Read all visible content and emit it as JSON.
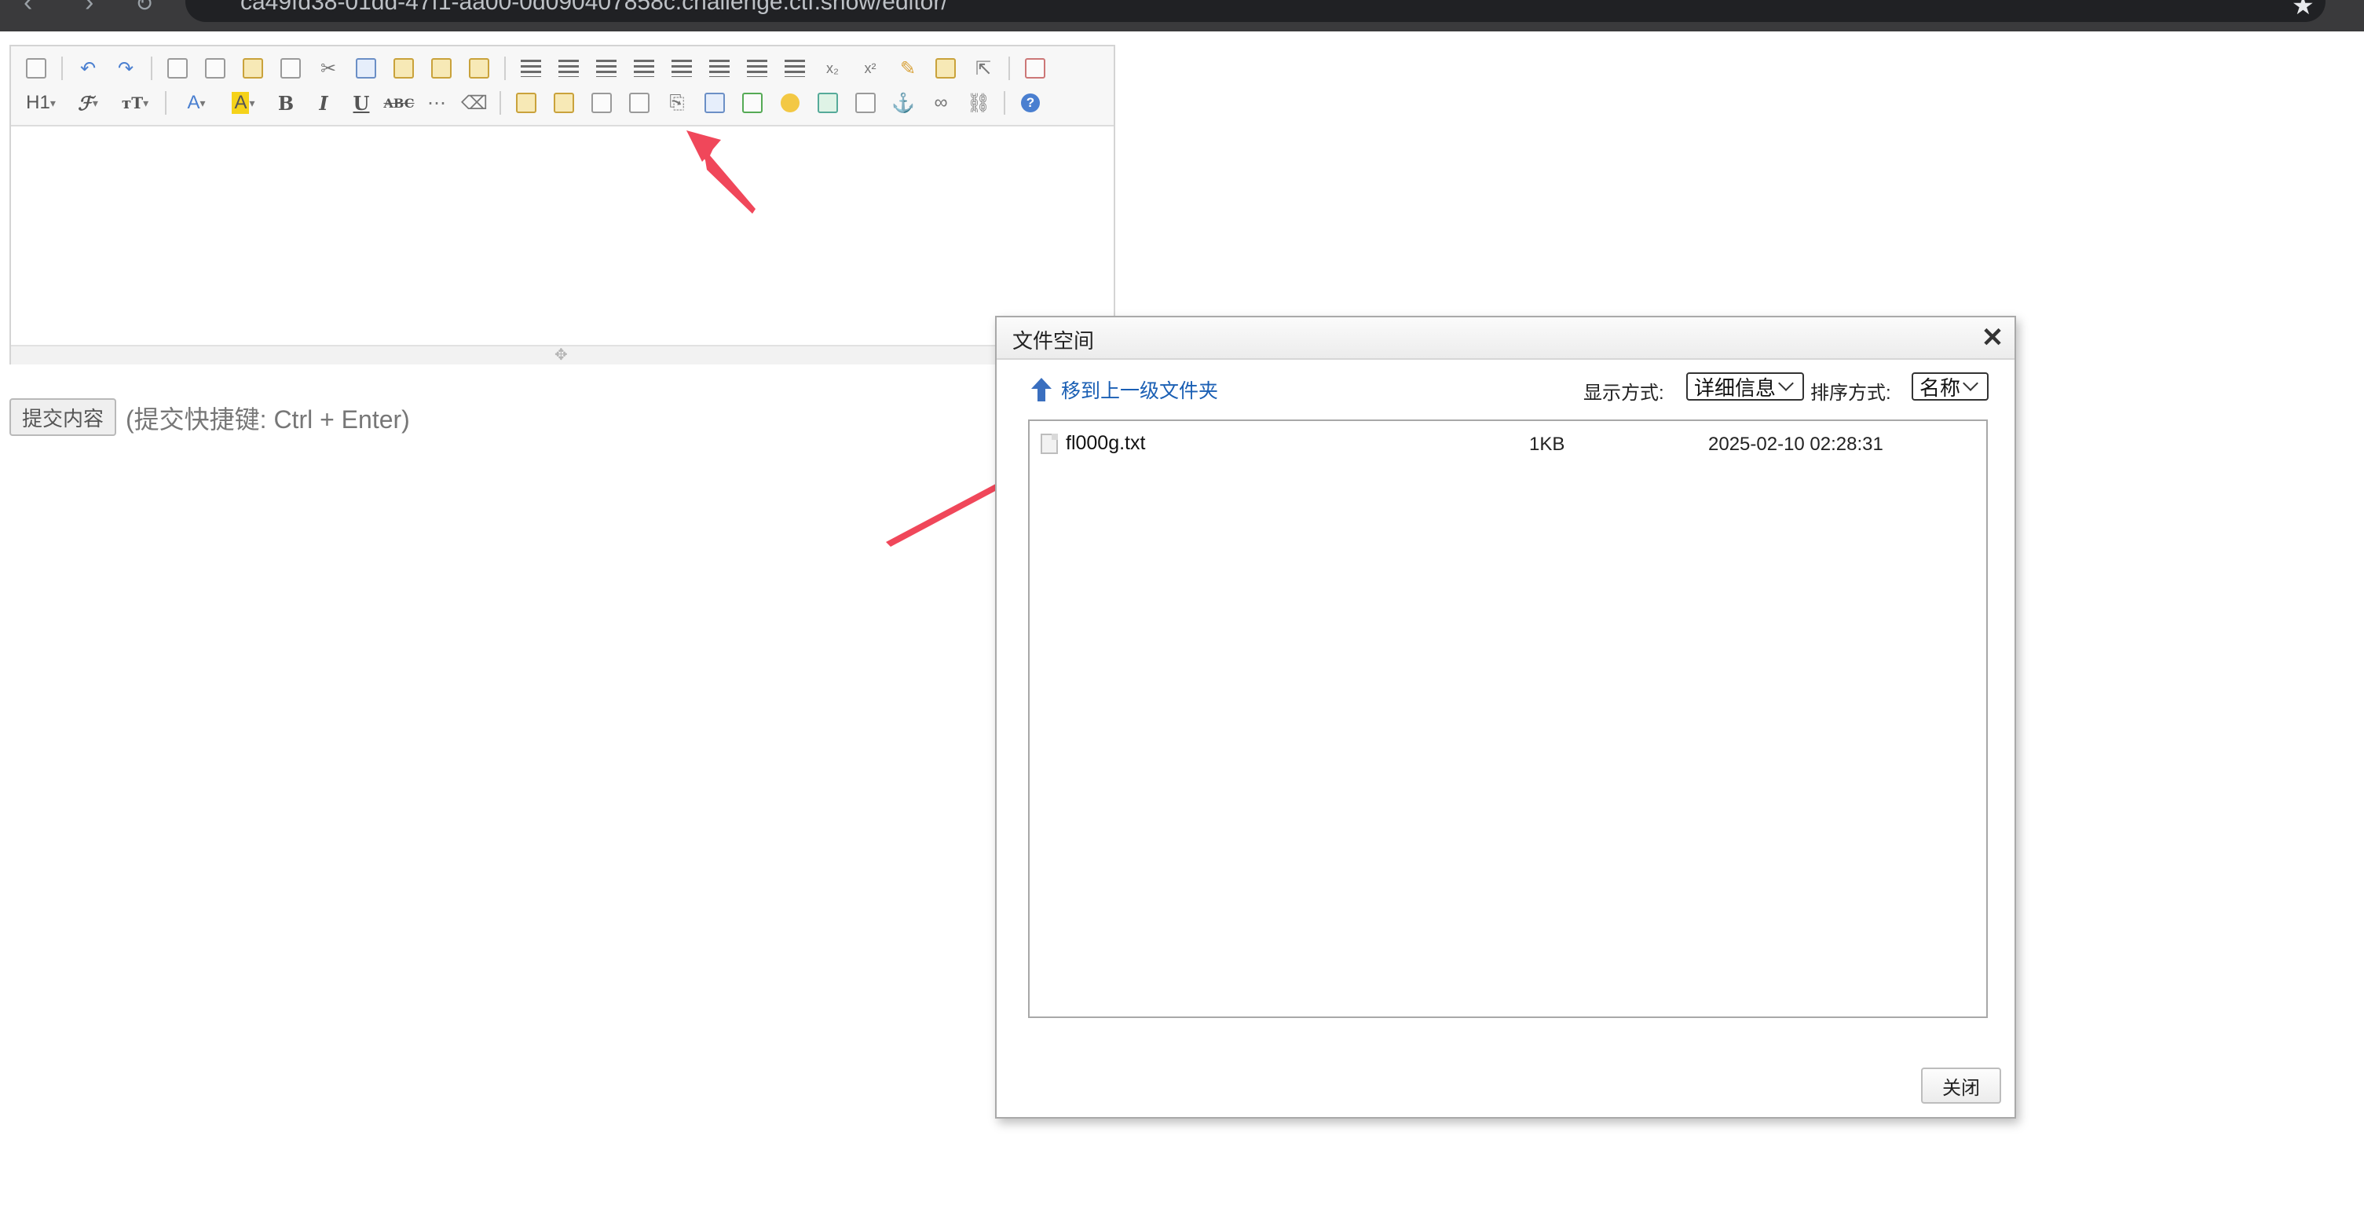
{
  "browser": {
    "url": "ca49fd38-01dd-47f1-aa00-0d090407858c.challenge.ctf.show/editor/"
  },
  "editor": {
    "toolbar_row1": [
      "source-icon",
      "undo-icon",
      "redo-icon",
      "preview-icon",
      "print-icon",
      "template-icon",
      "code-icon",
      "cut-icon",
      "copy-icon",
      "paste-icon",
      "paste-text-icon",
      "paste-word-icon",
      "align-left-icon",
      "align-center-icon",
      "align-right-icon",
      "justify-icon",
      "ordered-list-icon",
      "unordered-list-icon",
      "indent-icon",
      "outdent-icon",
      "subscript-icon",
      "superscript-icon",
      "clear-format-icon",
      "select-all-icon",
      "cursor-icon",
      "fullscreen-icon"
    ],
    "toolbar_row2": [
      "heading-icon",
      "font-family-icon",
      "font-size-icon",
      "font-color-icon",
      "highlight-icon",
      "bold-icon",
      "italic-icon",
      "underline-icon",
      "strikethrough-icon",
      "horizontal-rule-icon",
      "eraser-icon",
      "image-icon",
      "multi-image-icon",
      "flash-icon",
      "media-icon",
      "attachment-icon",
      "table-icon",
      "insert-line-icon",
      "emoticon-icon",
      "baidu-map-icon",
      "page-break-icon",
      "anchor-icon",
      "link-icon",
      "unlink-icon",
      "help-icon"
    ],
    "heading_label": "H1",
    "submit_label": "提交内容",
    "hint": "(提交快捷键: Ctrl + Enter)"
  },
  "dialog": {
    "title": "文件空间",
    "up_folder": "移到上一级文件夹",
    "view_label": "显示方式:",
    "view_value": "详细信息",
    "sort_label": "排序方式:",
    "sort_value": "名称",
    "files": [
      {
        "name": "fl000g.txt",
        "size": "1KB",
        "date": "2025-02-10 02:28:31"
      }
    ],
    "close_button": "关闭"
  },
  "colors": {
    "accent_arrow": "#f0475a",
    "link": "#1a5fb4"
  }
}
